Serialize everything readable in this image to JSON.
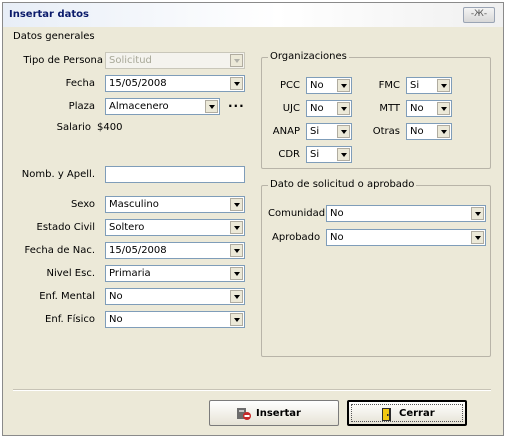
{
  "window": {
    "title": "Insertar datos",
    "close_label": "-Ж-"
  },
  "datos_generales": {
    "title": "Datos generales",
    "tipo_persona": {
      "label": "Tipo de Persona",
      "value": "Solicitud"
    },
    "fecha": {
      "label": "Fecha",
      "value": "15/05/2008"
    },
    "plaza": {
      "label": "Plaza",
      "value": "Almacenero",
      "dots": "..."
    },
    "salario": {
      "label": "Salario",
      "value": "$400"
    },
    "nombre": {
      "label": "Nomb. y Apell.",
      "value": ""
    },
    "sexo": {
      "label": "Sexo",
      "value": "Masculino"
    },
    "estado_civil": {
      "label": "Estado Civil",
      "value": "Soltero"
    },
    "fecha_nac": {
      "label": "Fecha de Nac.",
      "value": "15/05/2008"
    },
    "nivel_esc": {
      "label": "Nivel Esc.",
      "value": "Primaria"
    },
    "enf_mental": {
      "label": "Enf. Mental",
      "value": "No"
    },
    "enf_fisico": {
      "label": "Enf. Físico",
      "value": "No"
    }
  },
  "organizaciones": {
    "title": "Organizaciones",
    "pcc": {
      "label": "PCC",
      "value": "No"
    },
    "ujc": {
      "label": "UJC",
      "value": "No"
    },
    "anap": {
      "label": "ANAP",
      "value": "Si"
    },
    "cdr": {
      "label": "CDR",
      "value": "Si"
    },
    "fmc": {
      "label": "FMC",
      "value": "Si"
    },
    "mtt": {
      "label": "MTT",
      "value": "No"
    },
    "otras": {
      "label": "Otras",
      "value": "No"
    }
  },
  "solicitud": {
    "title": "Dato de solicitud o aprobado",
    "comunidad": {
      "label": "Comunidad",
      "value": "No"
    },
    "aprobado": {
      "label": "Aprobado",
      "value": "No"
    }
  },
  "buttons": {
    "insertar": "Insertar",
    "cerrar": "Cerrar"
  }
}
